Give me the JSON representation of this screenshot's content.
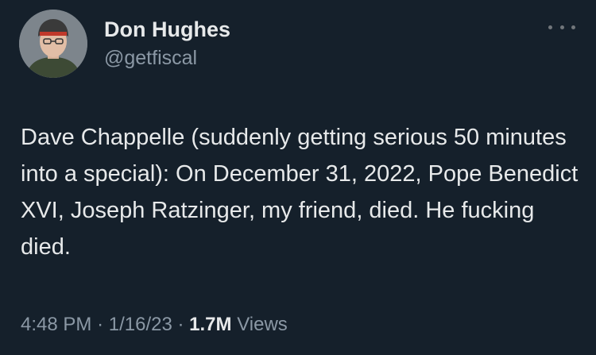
{
  "author": {
    "display_name": "Don Hughes",
    "handle": "@getfiscal",
    "avatar_icon": "profile-photo"
  },
  "tweet": {
    "text": "Dave Chappelle (suddenly getting serious 50 minutes into a special): On December 31, 2022, Pope Benedict XVI, Joseph Ratzinger, my friend, died. He fucking died.",
    "time": "4:48 PM",
    "date": "1/16/23",
    "views_count": "1.7M",
    "views_label": "Views",
    "separator": "·"
  },
  "menu": {
    "more_icon": "more-horizontal-icon"
  },
  "colors": {
    "background": "#15202b",
    "primary_text": "#e7e9ea",
    "secondary_text": "#8b98a5"
  }
}
